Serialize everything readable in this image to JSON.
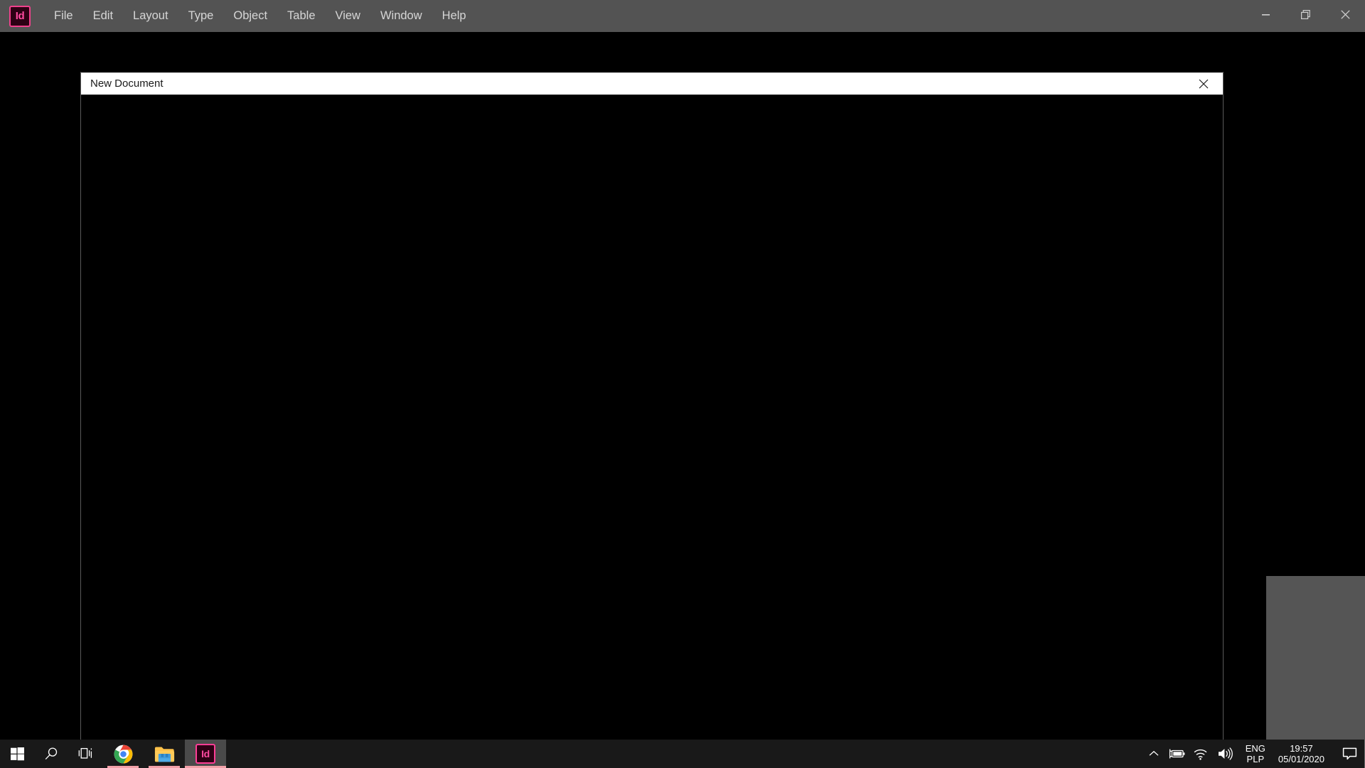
{
  "app": {
    "name": "Adobe InDesign",
    "logo_text": "Id",
    "logo_icon": "indesign-logo-icon",
    "accent_pink": "#ff3d95",
    "menubar_bg": "#535353",
    "workspace_bg": "#000000"
  },
  "menubar": {
    "items": [
      {
        "label": "File"
      },
      {
        "label": "Edit"
      },
      {
        "label": "Layout"
      },
      {
        "label": "Type"
      },
      {
        "label": "Object"
      },
      {
        "label": "Table"
      },
      {
        "label": "View"
      },
      {
        "label": "Window"
      },
      {
        "label": "Help"
      }
    ],
    "window_controls": [
      {
        "name": "minimize-button",
        "icon": "minimize-icon"
      },
      {
        "name": "restore-button",
        "icon": "restore-icon"
      },
      {
        "name": "close-button",
        "icon": "close-icon"
      }
    ]
  },
  "dialog": {
    "title": "New Document",
    "close_icon": "close-icon",
    "body_bg": "#000000"
  },
  "panel": {
    "name": "floating-panel",
    "color": "#555555"
  },
  "taskbar": {
    "bg": "#191919",
    "start": {
      "name": "start-button",
      "icon": "windows-logo-icon"
    },
    "search": {
      "name": "search-button",
      "icon": "search-icon"
    },
    "taskview": {
      "name": "task-view-button",
      "icon": "task-view-icon"
    },
    "apps": [
      {
        "name": "taskbar-app-chrome",
        "icon": "chrome-icon",
        "label": "Google Chrome",
        "running": true,
        "active": false
      },
      {
        "name": "taskbar-app-file-explorer",
        "icon": "folder-icon",
        "label": "File Explorer",
        "running": true,
        "active": false
      },
      {
        "name": "taskbar-app-indesign",
        "icon": "indesign-icon",
        "label": "Adobe InDesign",
        "running": true,
        "active": true,
        "tile_text": "Id"
      }
    ],
    "tray": {
      "overflow": {
        "name": "show-hidden-icons-button",
        "icon": "chevron-up-icon"
      },
      "battery": {
        "name": "battery-icon",
        "icon": "battery-charging-icon"
      },
      "network": {
        "name": "network-icon",
        "icon": "wifi-icon"
      },
      "volume": {
        "name": "volume-icon",
        "icon": "speaker-icon"
      },
      "language_top": "ENG",
      "language_bottom": "PLP",
      "time": "19:57",
      "date": "05/01/2020",
      "notifications": {
        "name": "action-center-button",
        "icon": "speech-bubble-icon"
      }
    }
  }
}
